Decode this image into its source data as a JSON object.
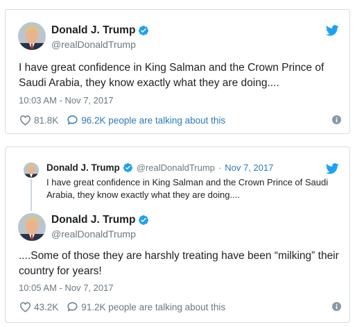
{
  "tweets": [
    {
      "display_name": "Donald J. Trump",
      "handle": "@realDonaldTrump",
      "text": "I have great confidence in King Salman and the Crown Prince of Saudi Arabia, they know exactly what they are doing....",
      "timestamp": "10:03 AM - Nov 7, 2017",
      "likes": "81.8K",
      "conversation": "96.2K people are talking about this"
    },
    {
      "parent": {
        "display_name": "Donald J. Trump",
        "handle": "@realDonaldTrump",
        "separator": "·",
        "date": "Nov 7, 2017",
        "text": "I have great confidence in King Salman and the Crown Prince of Saudi Arabia, they know exactly what they are doing...."
      },
      "display_name": "Donald J. Trump",
      "handle": "@realDonaldTrump",
      "text": "....Some of those they are harshly treating have been “milking” their country for years!",
      "timestamp": "10:05 AM - Nov 7, 2017",
      "likes": "43.2K",
      "conversation": "91.2K people are talking about this"
    }
  ],
  "colors": {
    "brand_blue": "#1da1f2",
    "link_blue": "#2b7bb9",
    "muted_text": "#697882",
    "border": "#d3dbe1"
  },
  "icons": [
    "avatar",
    "verified-badge-icon",
    "twitter-bird-icon",
    "heart-icon",
    "speech-bubble-icon",
    "info-icon"
  ]
}
